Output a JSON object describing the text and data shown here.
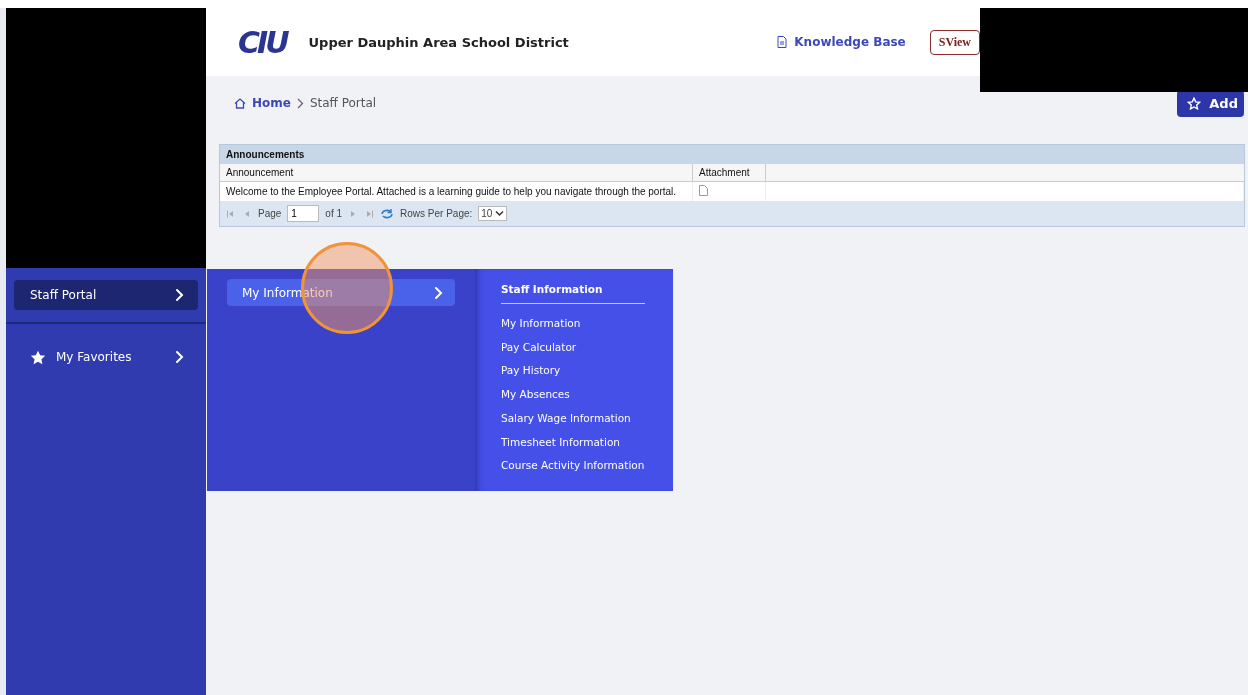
{
  "header": {
    "logo": "CIU",
    "district": "Upper Dauphin Area School District",
    "knowledge_link": "Knowledge Base",
    "view_button": "SView"
  },
  "redactions": {
    "sidebar_top": true,
    "header_right": true
  },
  "breadcrumb": [
    {
      "label": "Home",
      "kind": "home"
    },
    {
      "label": "Staff Portal",
      "kind": "current"
    }
  ],
  "add_button": "Add",
  "announcements": {
    "title": "Announcements",
    "columns": [
      "Announcement",
      "Attachment"
    ],
    "rows": [
      {
        "text": "Welcome to the Employee Portal. Attached is a learning guide to help you navigate through the portal.",
        "attachment": true
      }
    ],
    "pager": {
      "page_label": "Page",
      "page": "1",
      "of": "of 1",
      "rows_label": "Rows Per Page:",
      "rows_per_page": "10"
    }
  },
  "sidebar": {
    "items": [
      {
        "label": "Staff Portal",
        "kind": "plain",
        "selected": true
      },
      {
        "label": "My Favorites",
        "kind": "star",
        "selected": false
      }
    ]
  },
  "flyout": {
    "items": [
      {
        "label": "My Information",
        "selected": true
      }
    ],
    "section": {
      "title": "Staff Information",
      "links": [
        "My Information",
        "Pay Calculator",
        "Pay History",
        "My Absences",
        "Salary Wage Information",
        "Timesheet Information",
        "Course Activity Information"
      ]
    }
  },
  "click_marker": true
}
